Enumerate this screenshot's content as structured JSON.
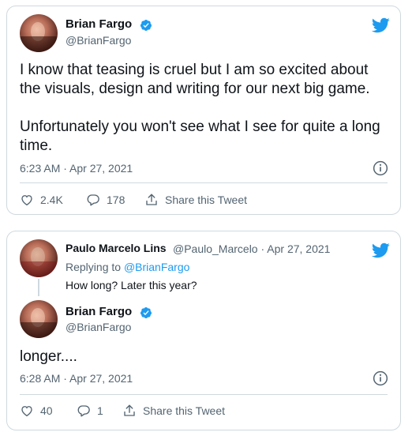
{
  "tweet1": {
    "name": "Brian Fargo",
    "handle": "@BrianFargo",
    "text": "I know that teasing is cruel but I am so excited about\nthe visuals, design and writing for our next big game.\n\nUnfortunately you won't see what I see for quite a long\ntime.",
    "timestamp": "6:23 AM · Apr 27, 2021",
    "likes": "2.4K",
    "replies": "178",
    "share_label": "Share this Tweet"
  },
  "tweet2": {
    "reply": {
      "name": "Paulo Marcelo Lins",
      "handle_date": "@Paulo_Marcelo · Apr 27, 2021",
      "replying_prefix": "Replying to ",
      "replying_handle": "@BrianFargo",
      "text": "How long? Later this year?"
    },
    "main": {
      "name": "Brian Fargo",
      "handle": "@BrianFargo",
      "text": "longer....",
      "timestamp": "6:28 AM · Apr 27, 2021",
      "likes": "40",
      "replies": "1",
      "share_label": "Share this Tweet"
    }
  },
  "colors": {
    "twitter_blue": "#1d9bf0",
    "text_secondary": "#536471",
    "border": "#cfd9de"
  },
  "icons": [
    "twitter-bird-icon",
    "verified-badge-icon",
    "info-icon",
    "heart-icon",
    "reply-icon",
    "share-icon"
  ]
}
